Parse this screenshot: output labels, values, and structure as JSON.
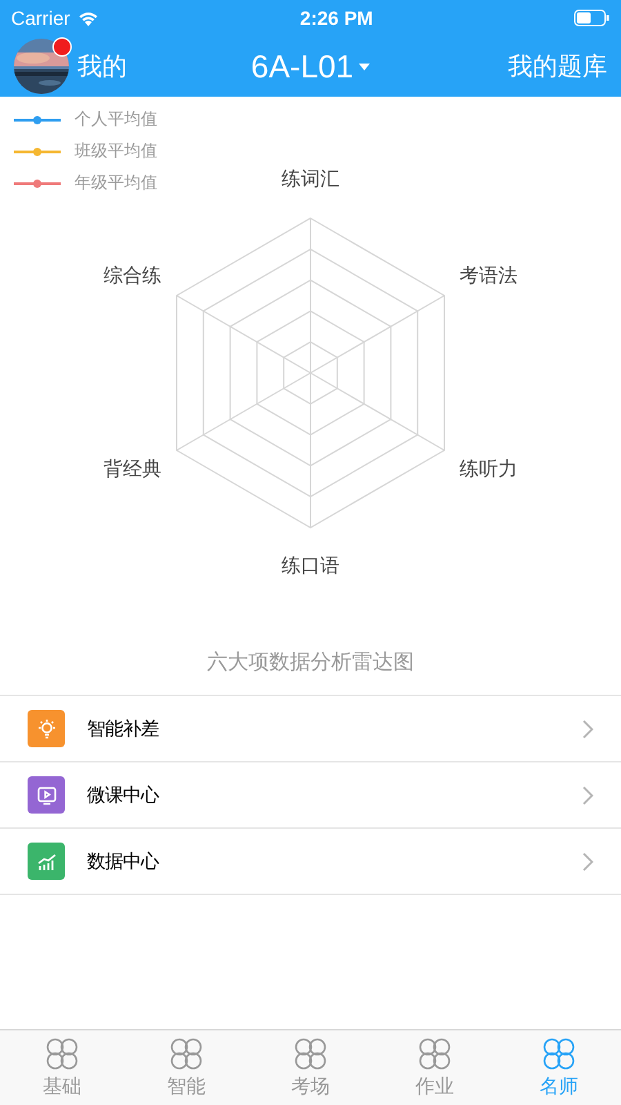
{
  "status_bar": {
    "carrier": "Carrier",
    "time": "2:26 PM"
  },
  "nav": {
    "left_label": "我的",
    "has_notification": true,
    "title": "6A-L01",
    "right_label": "我的题库"
  },
  "legend": [
    {
      "label": "个人平均值",
      "color": "#2f9ef0"
    },
    {
      "label": "班级平均值",
      "color": "#f5b731"
    },
    {
      "label": "年级平均值",
      "color": "#ef7a7a"
    }
  ],
  "radar": {
    "axes": [
      "练词汇",
      "考语法",
      "练听力",
      "练口语",
      "背经典",
      "综合练"
    ],
    "caption": "六大项数据分析雷达图"
  },
  "menu": [
    {
      "kind": "bulb",
      "label": "智能补差",
      "color": "#f7922e"
    },
    {
      "kind": "video",
      "label": "微课中心",
      "color": "#9466d3"
    },
    {
      "kind": "chart",
      "label": "数据中心",
      "color": "#3bb56b"
    }
  ],
  "tabs": [
    {
      "label": "基础",
      "selected": false
    },
    {
      "label": "智能",
      "selected": false
    },
    {
      "label": "考场",
      "selected": false
    },
    {
      "label": "作业",
      "selected": false
    },
    {
      "label": "名师",
      "selected": true
    }
  ]
}
